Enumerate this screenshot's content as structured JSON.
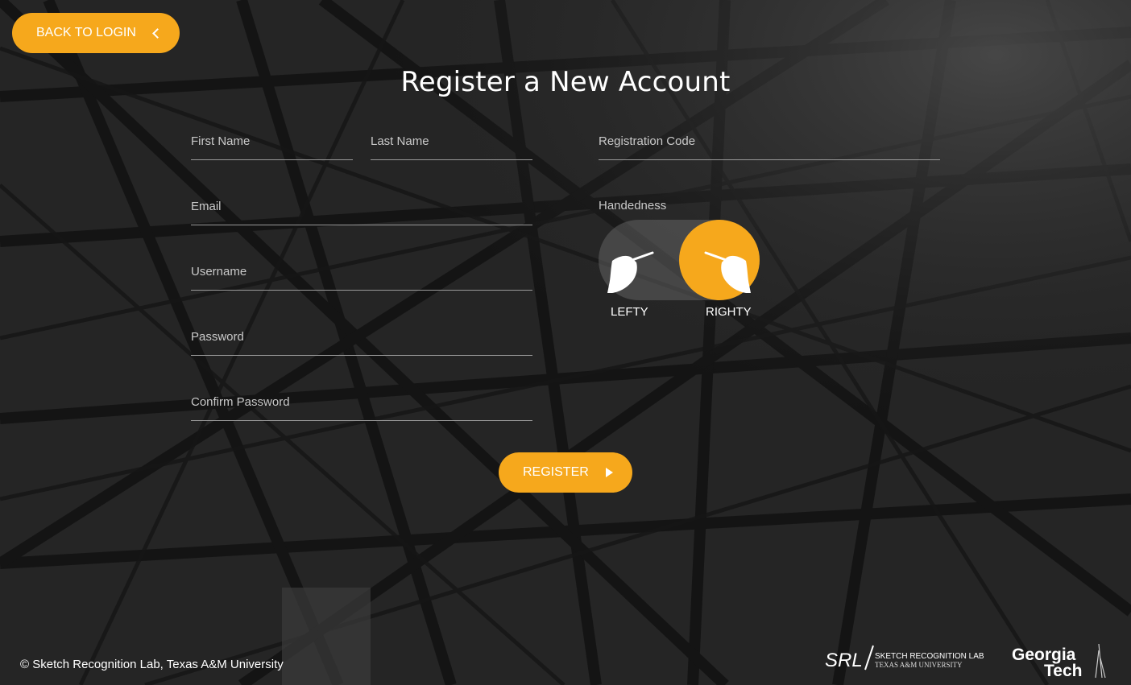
{
  "header": {
    "back_label": "BACK TO LOGIN",
    "title": "Register a New Account"
  },
  "form": {
    "first_name_label": "First Name",
    "last_name_label": "Last Name",
    "registration_code_label": "Registration Code",
    "email_label": "Email",
    "username_label": "Username",
    "password_label": "Password",
    "confirm_password_label": "Confirm Password",
    "handedness_label": "Handedness",
    "handedness_options": [
      "LEFTY",
      "RIGHTY"
    ],
    "handedness_selected": "RIGHTY",
    "submit_label": "REGISTER"
  },
  "footer": {
    "copyright": "© Sketch Recognition Lab, Texas A&M University",
    "logos": {
      "srl_mark": "SRL",
      "srl_line1": "SKETCH RECOGNITION LAB",
      "srl_line2": "TEXAS A&M UNIVERSITY",
      "gt_line1": "Georgia",
      "gt_line2": "Tech"
    }
  },
  "colors": {
    "accent": "#f6a81c",
    "background": "#222222",
    "field_line": "#9a9a9a",
    "label_text": "#c9c9c9"
  },
  "icons": [
    "chevron-left-icon",
    "lefty-hand-icon",
    "righty-hand-icon",
    "play-icon"
  ]
}
